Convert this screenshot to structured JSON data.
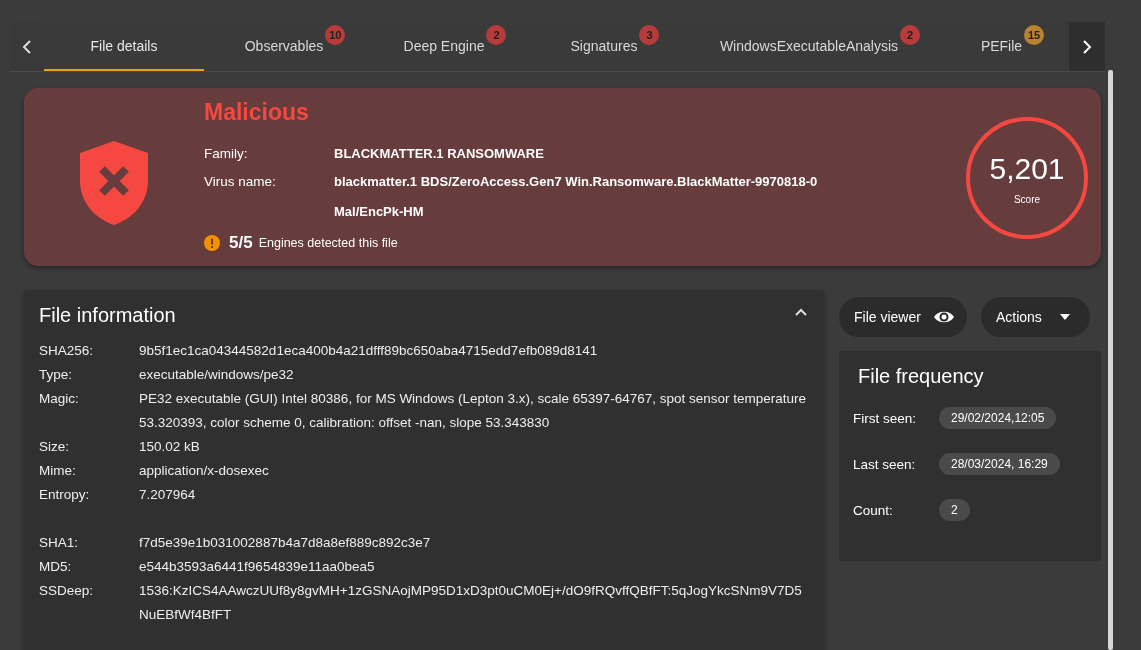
{
  "tabs": [
    {
      "label": "File details",
      "selected": true
    },
    {
      "label": "Observables",
      "selected": false,
      "badge": "10",
      "color": "#b83b3b"
    },
    {
      "label": "Deep Engine",
      "selected": false,
      "badge": "2",
      "color": "#b83b3b"
    },
    {
      "label": "Signatures",
      "selected": false,
      "badge": "3",
      "color": "#b83b3b"
    },
    {
      "label": "WindowsExecutableAnalysis",
      "selected": false,
      "badge": "2",
      "color": "#b83b3b"
    },
    {
      "label": "PEFile",
      "selected": false,
      "badge": "15",
      "color": "#b8822e"
    }
  ],
  "verdict": {
    "title": "Malicious",
    "fields": [
      {
        "label": "Family:",
        "values": [
          "BLACKMATTER.1 RANSOMWARE"
        ]
      },
      {
        "label": "Virus name:",
        "values": [
          "blackmatter.1 BDS/ZeroAccess.Gen7 Win.Ransomware.BlackMatter-9970818-0",
          "Mal/EncPk-HM"
        ]
      }
    ],
    "detections": "5/5",
    "detections_label": "Engines detected this file",
    "score": "5,201",
    "score_label": "Score"
  },
  "file_information": {
    "title": "File information",
    "expanded": true,
    "groups": [
      [
        {
          "label": "SHA256:",
          "value": "9b5f1ec1ca04344582d1eca400b4a21dfff89bc650aba4715edd7efb089d8141"
        },
        {
          "label": "Type:",
          "value": "executable/windows/pe32"
        },
        {
          "label": "Magic:",
          "value": "PE32 executable (GUI) Intel 80386, for MS Windows (Lepton 3.x), scale 65397-64767, spot sensor temperature 53.320393, color scheme 0, calibration: offset -nan, slope 53.343830"
        },
        {
          "label": "Size:",
          "value": "150.02 kB"
        },
        {
          "label": "Mime:",
          "value": "application/x-dosexec"
        },
        {
          "label": "Entropy:",
          "value": "7.207964"
        }
      ],
      [
        {
          "label": "SHA1:",
          "value": "f7d5e39e1b031002887b4a7d8a8ef889c892c3e7"
        },
        {
          "label": "MD5:",
          "value": "e544b3593a6441f9654839e11aa0bea5"
        },
        {
          "label": "SSDeep:",
          "value": "1536:KzICS4AAwczUUf8y8gvMH+1zGSNAojMP95D1xD3pt0uCM0Ej+/dO9fRQvffQBfFT:5qJogYkcSNm9V7D5NuEBfWf4BfFT"
        }
      ]
    ]
  },
  "buttons": [
    {
      "label": "File viewer",
      "kind": "eye"
    },
    {
      "label": "Actions",
      "kind": "menu"
    }
  ],
  "file_frequency": {
    "title": "File frequency",
    "rows": [
      {
        "label": "First seen:",
        "value": "29/02/2024,12:05"
      },
      {
        "label": "Last seen:",
        "value": "28/03/2024, 16:29"
      },
      {
        "label": "Count:",
        "value": "2"
      }
    ]
  }
}
